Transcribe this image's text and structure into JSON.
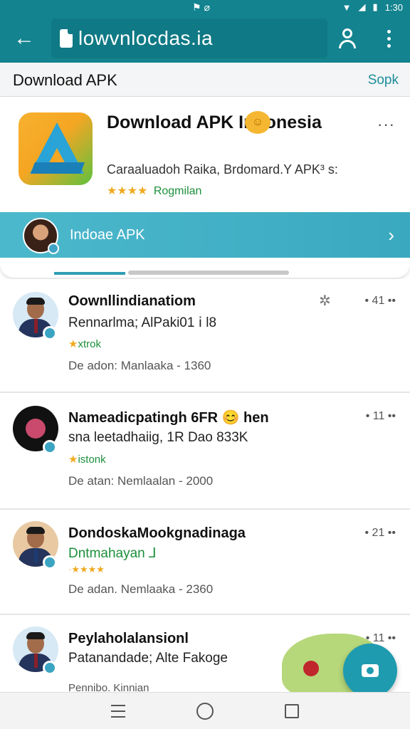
{
  "status_bar": {
    "left_icons": "⚑ ⌀",
    "time": "1:30"
  },
  "app_bar": {
    "url_text": "lowvnlocdas.ia"
  },
  "section": {
    "title": "Download APK",
    "action": "Sopk"
  },
  "feature": {
    "title": "Download APK Indonesia",
    "subtitle": "Caraaluadoh Raika, Brdomard.Y APK³ s:",
    "stars": "★★★★",
    "rating_label": "Rogmilan",
    "more": "···",
    "banner_text": "Indoae APK",
    "banner_chevron": "›"
  },
  "items": [
    {
      "title": "Oownllindianatiom",
      "subtitle": "Rennarlma; AlPaki01 ⅰ l8",
      "rating_stars": "★",
      "rating_label": "xtrok",
      "meta": "De adon: Manlaaka - 1360",
      "count": "• 41 ••"
    },
    {
      "title": "Nameadicpatingh 6FR 😊 hen",
      "subtitle": "sna leetadhaiig, 1R Dao 833K",
      "rating_stars": "★",
      "rating_label": "istonk",
      "meta": "De atan: Nemlaalan - 2000",
      "count": "• 11 ••"
    },
    {
      "title": "DondoskaMookgnadinaga",
      "subtitle": "Dntmahayan ⅃",
      "rating_stars": "·★★★★",
      "rating_label": "",
      "meta": "De adan. Nemlaaka - 2360",
      "count": "• 21 ••"
    },
    {
      "title": "Peylaholalansionl",
      "subtitle": "Patanandade; Alte Fakoge",
      "rating_stars": "",
      "rating_label": "",
      "meta": "Pennibo. Kinnian",
      "count": "• 11 ••"
    }
  ],
  "colors": {
    "primary": "#12838f",
    "accent": "#1f9bb0",
    "star": "#f0a91e",
    "rating_green": "#1c8f3a"
  },
  "icons": [
    "back-arrow-icon",
    "document-icon",
    "user-icon",
    "more-vert-icon",
    "chevron-right-icon",
    "camera-icon",
    "menu-icon",
    "home-icon",
    "recents-icon"
  ]
}
